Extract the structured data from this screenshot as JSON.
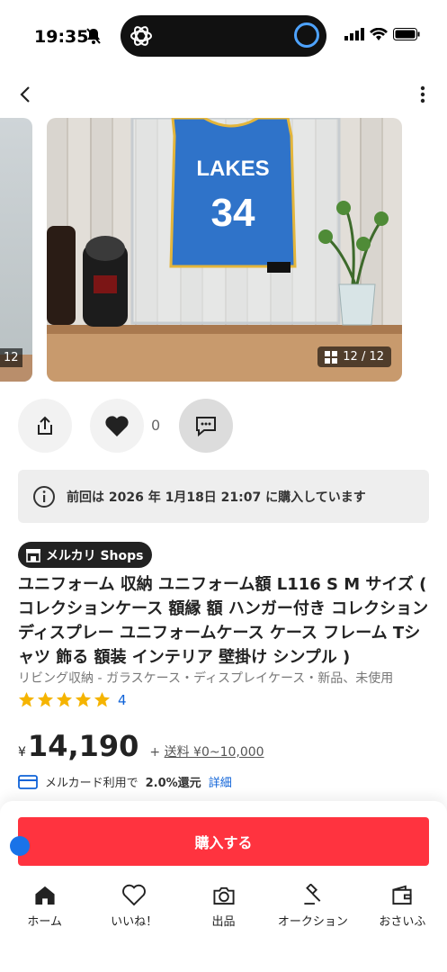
{
  "status_bar": {
    "time": "19:35"
  },
  "gallery": {
    "prev_badge": "12",
    "counter": "12 / 12",
    "jersey_team": "LAKES",
    "jersey_number": "34"
  },
  "actions": {
    "like_count": "0"
  },
  "notice": {
    "text": "前回は 2026 年 1月18日 21:07 に購入しています"
  },
  "shops_badge": "メルカリ Shops",
  "product": {
    "title": "ユニフォーム 収納 ユニフォーム額 L116 S M サイズ ( コレクションケース 額縁 額 ハンガー付き コレクション ディスプレー ユニフォームケース ケース フレーム Tシャツ 飾る 額装 インテリア 壁掛け シンプル )",
    "category": "リビング収納 - ガラスケース・ディスプレイケース・新品、未使用",
    "rating_stars": 5,
    "review_count": "4",
    "currency": "¥",
    "price": "14,190",
    "shipping_prefix": "+",
    "shipping_label": "送料 ¥0~10,000"
  },
  "mercard": {
    "text": "メルカード利用で",
    "rate": "2.0%還元",
    "link": "詳細"
  },
  "buy_button": "購入する",
  "tabbar": {
    "items": [
      {
        "label": "ホーム"
      },
      {
        "label": "いいね！"
      },
      {
        "label": "出品"
      },
      {
        "label": "オークション"
      },
      {
        "label": "おさいふ"
      }
    ]
  },
  "colors": {
    "accent": "#ff333f",
    "link": "#0f63d8",
    "star": "#f5b400"
  }
}
